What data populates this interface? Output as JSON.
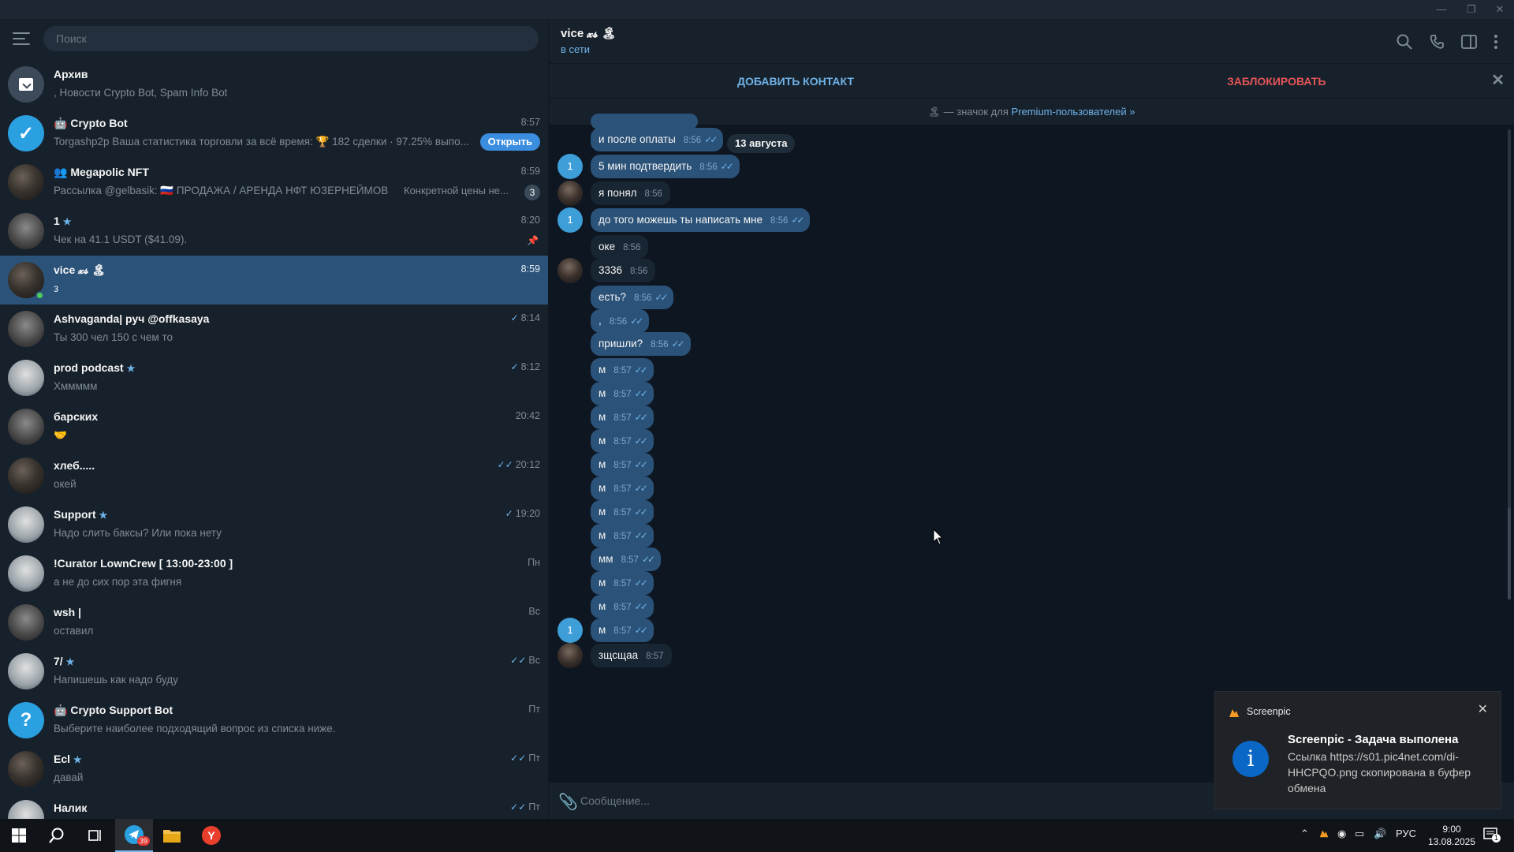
{
  "window": {
    "minimize": "—",
    "maximize": "❐",
    "close": "✕"
  },
  "search": {
    "placeholder": "Поиск"
  },
  "chats": [
    {
      "name": "Архив",
      "preview": ", Новости Crypto Bot, Spam Info Bot"
    },
    {
      "name": "Crypto Bot",
      "preview": "Torgashp2p  Ваша статистика торговли за всё время: 🏆 182 сделки · 97.25% выпо...",
      "time": "8:57",
      "button": "Открыть"
    },
    {
      "name": "Megapolic NFT",
      "preview": "Рассылка @gelbasik: 🇷🇺 ПРОДАЖА / АРЕНДА  НФТ  ЮЗЕРНЕЙМОВ",
      "extra": "Конкретной цены не...",
      "time": "8:59",
      "badge": "3"
    },
    {
      "name": "1",
      "preview": "Чек на  41.1 USDT ($41.09).",
      "time": "8:20"
    },
    {
      "name": "vice 𝔁𝓼 🏝",
      "preview": "з",
      "time": "8:59"
    },
    {
      "name": "Ashvaganda| руч @offkasaya",
      "preview": "Ты 300 чел 150 с чем то",
      "time": "8:14"
    },
    {
      "name": "prod podcast",
      "preview": "Хммммм",
      "time": "8:12"
    },
    {
      "name": "барских",
      "preview": "🤝",
      "time": "20:42"
    },
    {
      "name": "хлеб.....",
      "preview": "окей",
      "time": "20:12"
    },
    {
      "name": "Support",
      "preview": "Надо слить баксы? Или пока нету",
      "time": "19:20"
    },
    {
      "name": "!Curator LownCrew [ 13:00-23:00 ]",
      "preview": "а не до сих пор эта фигня",
      "time": "Пн"
    },
    {
      "name": "wsh |",
      "preview": "оставил",
      "time": "Вс"
    },
    {
      "name": "7/",
      "preview": "Напишешь как надо буду",
      "time": "Вс"
    },
    {
      "name": "Crypto Support Bot",
      "preview": "Выберите наиболее подходящий вопрос из списка ниже.",
      "time": "Пт"
    },
    {
      "name": "Ecl",
      "preview": "давай",
      "time": "Пт"
    },
    {
      "name": "Налик",
      "preview": "",
      "time": "Пт"
    }
  ],
  "header": {
    "name": "vice 𝔁𝓼 🏝",
    "status": "в сети"
  },
  "actions": {
    "add": "ДОБАВИТЬ КОНТАКТ",
    "block": "ЗАБЛОКИРОВАТЬ",
    "close": "✕"
  },
  "premium": {
    "prefix": "🏝 — значок для",
    "link": "Premium-пользователей »"
  },
  "date_pill": "13 августа",
  "messages": [
    {
      "text": "и после оплаты",
      "time": "8:56",
      "out": true
    },
    {
      "text": "5 мин подтвердить",
      "time": "8:56",
      "out": true
    },
    {
      "text": "я понял",
      "time": "8:56",
      "out": false
    },
    {
      "text": "до того можешь ты написать мне",
      "time": "8:56",
      "out": true
    },
    {
      "text": "оке",
      "time": "8:56",
      "out": false
    },
    {
      "text": "3336",
      "time": "8:56",
      "out": false
    },
    {
      "text": "есть?",
      "time": "8:56",
      "out": true
    },
    {
      "text": ",",
      "time": "8:56",
      "out": true
    },
    {
      "text": "пришли?",
      "time": "8:56",
      "out": true
    },
    {
      "text": "м",
      "time": "8:57",
      "out": true
    },
    {
      "text": "м",
      "time": "8:57",
      "out": true
    },
    {
      "text": "м",
      "time": "8:57",
      "out": true
    },
    {
      "text": "м",
      "time": "8:57",
      "out": true
    },
    {
      "text": "м",
      "time": "8:57",
      "out": true
    },
    {
      "text": "м",
      "time": "8:57",
      "out": true
    },
    {
      "text": "м",
      "time": "8:57",
      "out": true
    },
    {
      "text": "м",
      "time": "8:57",
      "out": true
    },
    {
      "text": "мм",
      "time": "8:57",
      "out": true
    },
    {
      "text": "м",
      "time": "8:57",
      "out": true
    },
    {
      "text": "м",
      "time": "8:57",
      "out": true
    },
    {
      "text": "м",
      "time": "8:57",
      "out": true
    },
    {
      "text": "зщсщаа",
      "time": "8:57",
      "out": false
    }
  ],
  "avatars": {
    "me_letter": "1"
  },
  "composer": {
    "placeholder": "Сообщение..."
  },
  "notification": {
    "app": "Screenpic",
    "title": "Screenpic - Задача выполена",
    "body": "Ссылка https://s01.pic4net.com/di-HHCPQO.png скопирована в буфер обмена",
    "icon_letter": "i",
    "close": "✕"
  },
  "taskbar": {
    "telegram_badge": "39",
    "lang": "РУС",
    "time": "9:00",
    "date": "13.08.2025",
    "notif_count": "1"
  },
  "colors": {
    "accent": "#6fb2e8",
    "block": "#e45457",
    "active": "#2b5278",
    "bg": "#0e1621"
  }
}
